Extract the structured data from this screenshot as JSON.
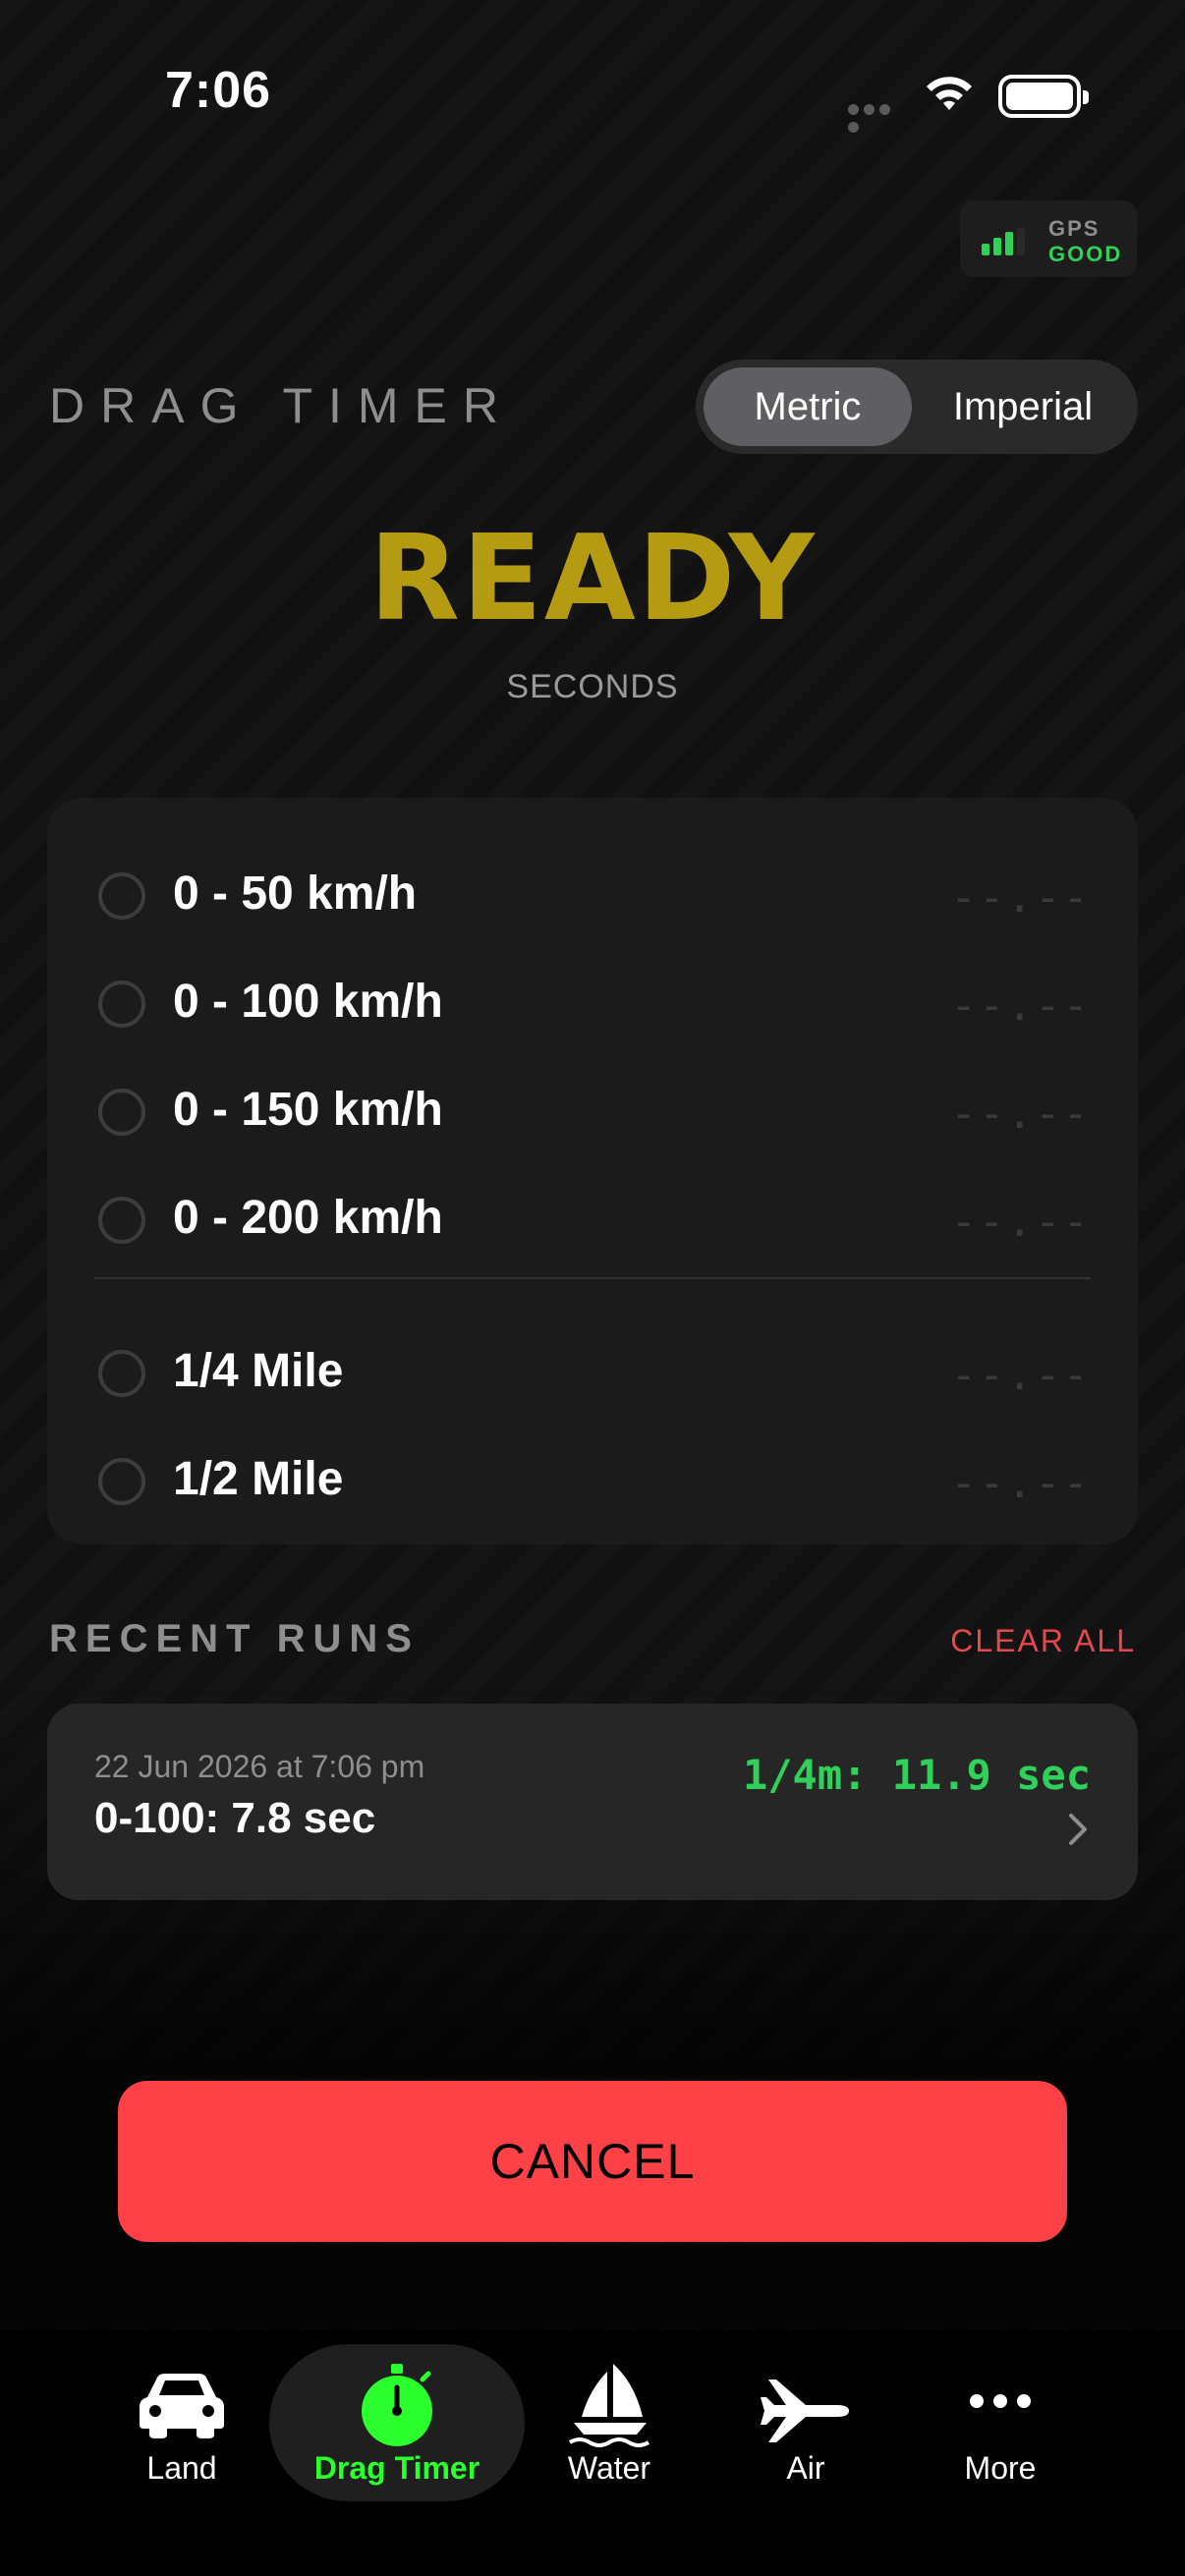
{
  "status_bar": {
    "time": "7:06"
  },
  "gps": {
    "label": "GPS",
    "status": "GOOD"
  },
  "header": {
    "title": "DRAG TIMER",
    "units": [
      "Metric",
      "Imperial"
    ],
    "selected_unit": "Metric"
  },
  "timer": {
    "state": "READY",
    "unit_label": "SECONDS"
  },
  "metrics": [
    {
      "label": "0 - 50 km/h",
      "value": "--.--"
    },
    {
      "label": "0 - 100 km/h",
      "value": "--.--"
    },
    {
      "label": "0 - 150 km/h",
      "value": "--.--"
    },
    {
      "label": "0 - 200 km/h",
      "value": "--.--"
    },
    {
      "label": "1/4 Mile",
      "value": "--.--"
    },
    {
      "label": "1/2 Mile",
      "value": "--.--"
    }
  ],
  "recent": {
    "title": "RECENT RUNS",
    "clear_label": "CLEAR ALL",
    "runs": [
      {
        "date": "22 Jun 2026 at 7:06 pm",
        "primary": "0-100: 7.8 sec",
        "best": "1/4m: 11.9 sec"
      }
    ]
  },
  "cancel_label": "CANCEL",
  "tabs": [
    {
      "label": "Land",
      "icon": "car-icon"
    },
    {
      "label": "Drag Timer",
      "icon": "stopwatch-icon",
      "active": true
    },
    {
      "label": "Water",
      "icon": "sailboat-icon"
    },
    {
      "label": "Air",
      "icon": "airplane-icon"
    },
    {
      "label": "More",
      "icon": "ellipsis-icon"
    }
  ],
  "colors": {
    "accent_green": "#2fd158",
    "ready_gold": "#b49b12",
    "cancel_red": "#fe4047",
    "clear_red": "#e5484d"
  }
}
